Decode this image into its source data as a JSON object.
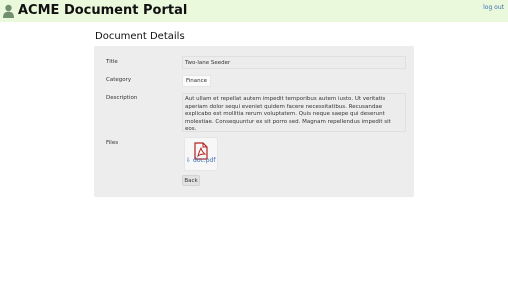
{
  "header": {
    "app_title": "ACME Document Portal",
    "logout_label": "log out",
    "user_icon": "user-icon"
  },
  "page": {
    "title": "Document Details"
  },
  "details": {
    "title_label": "Title",
    "title_value": "Two-lane Seeder",
    "category_label": "Category",
    "category_value": "Finance",
    "description_label": "Description",
    "description_value": "Aut ullam et repellat autem impedit temporibus autem iusto. Ut veritatis aperiam dolor sequi eveniet quidem facere necessitatibus. Recusandae explicabo est mollitia rerum voluptatem. Quis neque saepe qui deserunt molestiae. Consequuntur ex sit porro sed. Magnam repellendus impedit sit eos.",
    "files_label": "Files",
    "file_name": "doc.pdf",
    "file_icon": "pdf-file-icon",
    "download_icon": "download-icon",
    "back_label": "Back"
  },
  "colors": {
    "header_bg": "#eaf8dc",
    "panel_bg": "#ededed",
    "link": "#3a6fb0",
    "pdf_red": "#b22222"
  }
}
